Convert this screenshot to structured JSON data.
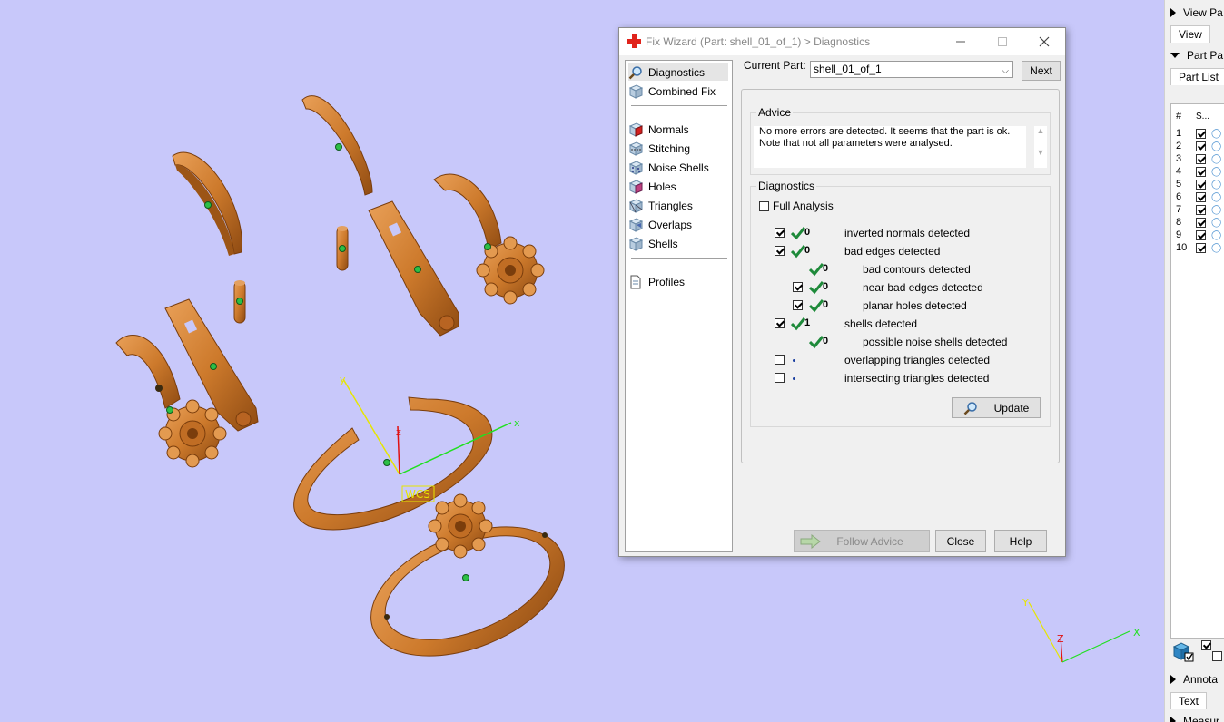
{
  "viewport": {
    "wcs_label": "WCS",
    "axes": {
      "x": "x",
      "y": "y",
      "z": "z"
    },
    "mini_axes": {
      "x": "X",
      "y": "Y",
      "z": "Z"
    },
    "colors": {
      "background": "#c8c8fa",
      "part": "#cd7a2c",
      "point": "#2dbf46"
    }
  },
  "right_panel": {
    "view_section": "View Pa",
    "view_tab": "View",
    "part_section": "Part Pa",
    "part_list_tab": "Part List",
    "col_num": "#",
    "col_state": "S...",
    "rows": [
      "1",
      "2",
      "3",
      "4",
      "5",
      "6",
      "7",
      "8",
      "9",
      "10"
    ],
    "annot_section": "Annota",
    "text_tab": "Text",
    "measure_section": "Measur"
  },
  "dialog": {
    "title": "Fix Wizard (Part: shell_01_of_1) > Diagnostics",
    "current_part_label": "Current Part:",
    "current_part_value": "shell_01_of_1",
    "next_label": "Next",
    "nav": {
      "diagnostics": "Diagnostics",
      "combined_fix": "Combined Fix",
      "normals": "Normals",
      "stitching": "Stitching",
      "noise_shells": "Noise Shells",
      "holes": "Holes",
      "triangles": "Triangles",
      "overlaps": "Overlaps",
      "shells": "Shells",
      "profiles": "Profiles"
    },
    "advice_label": "Advice",
    "advice_line1": "No more errors are detected. It seems that the part is ok.",
    "advice_line2": "Note that not all parameters were analysed.",
    "diagnostics_label": "Diagnostics",
    "full_analysis_label": "Full Analysis",
    "rows": [
      {
        "count": "0",
        "label": "inverted normals detected"
      },
      {
        "count": "0",
        "label": "bad edges detected"
      },
      {
        "count": "0",
        "label": "bad contours detected"
      },
      {
        "count": "0",
        "label": "near bad edges detected"
      },
      {
        "count": "0",
        "label": "planar holes detected"
      },
      {
        "count": "1",
        "label": "shells detected"
      },
      {
        "count": "0",
        "label": "possible noise shells detected"
      },
      {
        "count": "",
        "label": "overlapping triangles detected"
      },
      {
        "count": "",
        "label": "intersecting triangles detected"
      }
    ],
    "update_label": "Update",
    "follow_advice_label": "Follow Advice",
    "close_label": "Close",
    "help_label": "Help"
  }
}
